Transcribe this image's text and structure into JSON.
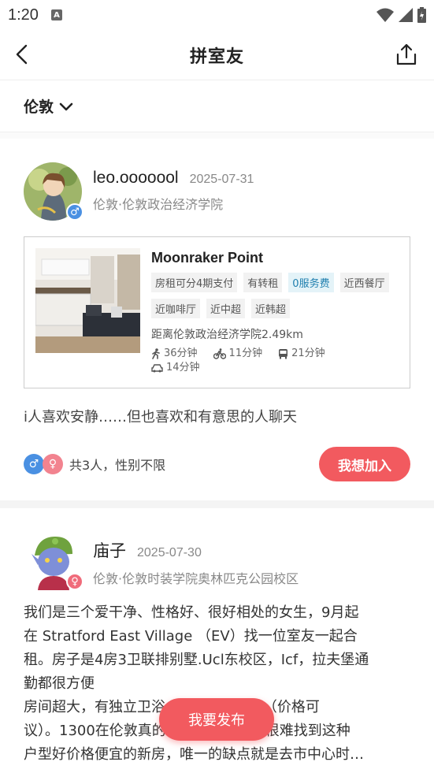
{
  "status_bar": {
    "time": "1:20"
  },
  "nav": {
    "title": "拼室友"
  },
  "filter": {
    "city": "伦敦"
  },
  "posts": [
    {
      "username": "leo.ooooool",
      "date": "2025-07-31",
      "gender": "male",
      "location": "伦敦·伦敦政治经济学院",
      "property": {
        "name": "Moonraker Point",
        "tags": [
          "房租可分4期支付",
          "有转租",
          "0服务费",
          "近西餐厅",
          "近咖啡厅",
          "近中超",
          "近韩超"
        ],
        "distance": "距离伦敦政治经济学院2.49km",
        "commute": {
          "walk": "36分钟",
          "bike": "11分钟",
          "bus": "21分钟",
          "car": "14分钟"
        }
      },
      "description": "i人喜欢安静……但也喜欢和有意思的人聊天",
      "people": "共3人，性别不限",
      "join_label": "我想加入"
    },
    {
      "username": "庙子",
      "date": "2025-07-30",
      "gender": "female",
      "location": "伦敦·伦敦时装学院奥林匹克公园校区",
      "text_lines": [
        "我们是三个爱干净、性格好、很好相处的女生，9月起",
        "在 Stratford East Village （EV）找一位室友一起合",
        "租。房子是4房3卫联排别墅.Ucl东校区，Icf，拉夫堡通",
        "勤都很方便",
        "房间超大，有独立卫浴，租金1300/月（价格可",
        "议）。1300在伦敦真的很划算了，根本很难找到这种",
        "户型好价格便宜的新房，唯一的缺点就是去市中心时…"
      ]
    }
  ],
  "publish_label": "我要发布"
}
